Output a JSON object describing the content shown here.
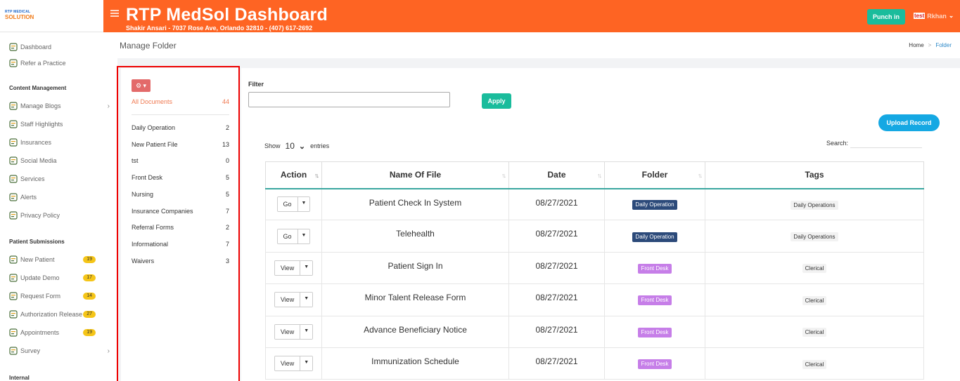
{
  "brand": {
    "logo_line1": "RTP MEDICAL",
    "logo_line2": "SOLUTION"
  },
  "header": {
    "title": "RTP MedSol Dashboard",
    "subtitle": "Shakir Ansari - 7037 Rose Ave, Orlando 32810 - (407) 617-2692",
    "punch_label": "Punch in",
    "user_flag": "test",
    "user_name": "Rkhan"
  },
  "sidebar": {
    "items_top": [
      {
        "label": "Dashboard",
        "icon": "dashboard-icon"
      },
      {
        "label": "Refer a Practice",
        "icon": "gift-icon"
      }
    ],
    "section_content": "Content Management",
    "items_content": [
      {
        "label": "Manage Blogs",
        "icon": "blog-icon",
        "has_arrow": true
      },
      {
        "label": "Staff Highlights",
        "icon": "staff-icon"
      },
      {
        "label": "Insurances",
        "icon": "insurance-icon"
      },
      {
        "label": "Social Media",
        "icon": "social-icon"
      },
      {
        "label": "Services",
        "icon": "services-icon"
      },
      {
        "label": "Alerts",
        "icon": "alert-icon"
      },
      {
        "label": "Privacy Policy",
        "icon": "privacy-icon"
      }
    ],
    "section_patient": "Patient Submissions",
    "items_patient": [
      {
        "label": "New Patient",
        "badge": "19",
        "icon": "clipboard-icon"
      },
      {
        "label": "Update Demo",
        "badge": "17",
        "icon": "update-icon"
      },
      {
        "label": "Request Form",
        "badge": "14",
        "icon": "request-icon"
      },
      {
        "label": "Authorization Release",
        "badge": "27",
        "icon": "authorization-icon"
      },
      {
        "label": "Appointments",
        "badge": "19",
        "icon": "calendar-icon"
      },
      {
        "label": "Survey",
        "icon": "survey-icon",
        "has_arrow": true
      }
    ],
    "section_internal": "Internal"
  },
  "page": {
    "title": "Manage Folder",
    "breadcrumb_home": "Home",
    "breadcrumb_sep": ">",
    "breadcrumb_current": "Folder"
  },
  "folders": {
    "all_label": "All Documents",
    "all_count": "44",
    "items": [
      {
        "name": "Daily Operation",
        "count": "2"
      },
      {
        "name": "New Patient File",
        "count": "13"
      },
      {
        "name": "tst",
        "count": "0"
      },
      {
        "name": "Front Desk",
        "count": "5"
      },
      {
        "name": "Nursing",
        "count": "5"
      },
      {
        "name": "Insurance Companies",
        "count": "7"
      },
      {
        "name": "Referral Forms",
        "count": "2"
      },
      {
        "name": "Informational",
        "count": "7"
      },
      {
        "name": "Waivers",
        "count": "3"
      }
    ]
  },
  "filter": {
    "label": "Filter",
    "value": "",
    "apply_label": "Apply"
  },
  "upload_label": "Upload Record",
  "table_controls": {
    "show_label": "Show",
    "entries_value": "10",
    "entries_label": "entries",
    "search_label": "Search:",
    "search_value": ""
  },
  "table": {
    "columns": [
      "Action",
      "Name Of File",
      "Date",
      "Folder",
      "Tags"
    ],
    "rows": [
      {
        "action": "Go",
        "name": "Patient Check In System",
        "date": "08/27/2021",
        "folder": "Daily Operation",
        "folder_kind": "daily",
        "tag": "Daily Operations"
      },
      {
        "action": "Go",
        "name": "Telehealth",
        "date": "08/27/2021",
        "folder": "Daily Operation",
        "folder_kind": "daily",
        "tag": "Daily Operations"
      },
      {
        "action": "View",
        "name": "Patient Sign In",
        "date": "08/27/2021",
        "folder": "Front Desk",
        "folder_kind": "front",
        "tag": "Clerical"
      },
      {
        "action": "View",
        "name": "Minor Talent Release Form",
        "date": "08/27/2021",
        "folder": "Front Desk",
        "folder_kind": "front",
        "tag": "Clerical"
      },
      {
        "action": "View",
        "name": "Advance Beneficiary Notice",
        "date": "08/27/2021",
        "folder": "Front Desk",
        "folder_kind": "front",
        "tag": "Clerical"
      },
      {
        "action": "View",
        "name": "Immunization Schedule",
        "date": "08/27/2021",
        "folder": "Front Desk",
        "folder_kind": "front",
        "tag": "Clerical"
      }
    ]
  },
  "colors": {
    "orange": "#fe6423",
    "teal": "#1abc9c",
    "blue": "#15a8e3",
    "daily_badge": "#2c4a7a",
    "front_badge": "#c67ee8",
    "highlight": "#ee0000"
  }
}
